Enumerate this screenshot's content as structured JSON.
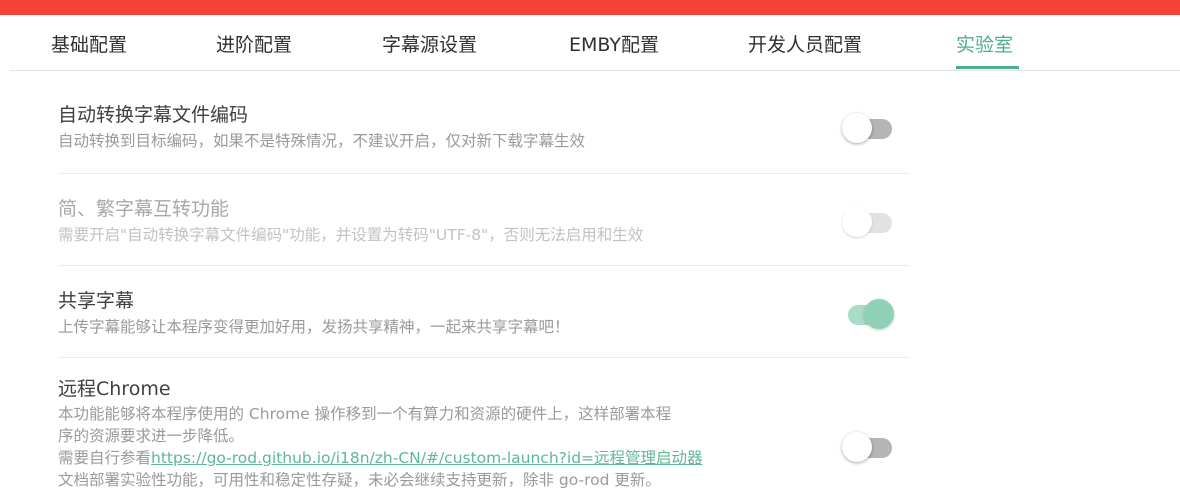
{
  "colors": {
    "top_bar": "#f44336",
    "accent": "#4caf89",
    "link": "#5fb894"
  },
  "tabs": [
    {
      "label": "基础配置"
    },
    {
      "label": "进阶配置"
    },
    {
      "label": "字幕源设置"
    },
    {
      "label": "EMBY配置"
    },
    {
      "label": "开发人员配置"
    },
    {
      "label": "实验室",
      "active": true
    }
  ],
  "settings": [
    {
      "title": "自动转换字幕文件编码",
      "description": "自动转换到目标编码，如果不是特殊情况，不建议开启，仅对新下载字幕生效",
      "toggle": "off"
    },
    {
      "title": "简、繁字幕互转功能",
      "description": "需要开启\"自动转换字幕文件编码\"功能，并设置为转码\"UTF-8\"，否则无法启用和生效",
      "toggle": "off-disabled"
    },
    {
      "title": "共享字幕",
      "description": "上传字幕能够让本程序变得更加好用，发扬共享精神，一起来共享字幕吧！",
      "toggle": "on"
    },
    {
      "title": "远程Chrome",
      "description_line1": "本功能能够将本程序使用的 Chrome 操作移到一个有算力和资源的硬件上，这样部署本程",
      "description_line2": "序的资源要求进一步降低。",
      "description_line3_prefix": "需要自行参看",
      "description_link": "https://go-rod.github.io/i18n/zh-CN/#/custom-launch?id=远程管理启动器",
      "description_line4": "文档部署实验性功能，可用性和稳定性存疑，未必会继续支持更新，除非 go-rod 更新。",
      "toggle": "off"
    }
  ]
}
